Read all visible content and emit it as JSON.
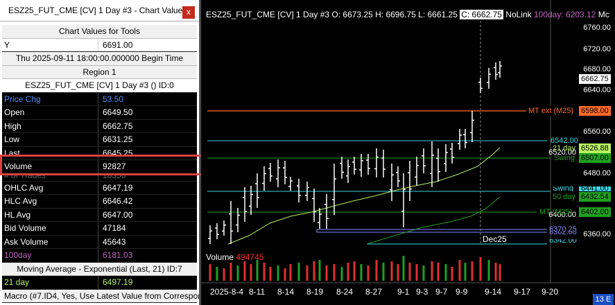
{
  "panel": {
    "title": "ESZ25_FUT_CME [CV]  1 Day  #3 - Chart Values...",
    "close": "x",
    "header": "Chart Values for Tools",
    "y_label": "Y",
    "y_value": "6691.00",
    "time": "Thu 2025-09-11  18:00:00.000000 Begin Time",
    "region": "Region 1",
    "symbol": "ESZ25_FUT_CME [CV]  1 Day  #3 ()   ID:0",
    "rows": [
      {
        "label": "Price Chg",
        "value": "53.50"
      },
      {
        "label": "Open",
        "value": "6649.50"
      },
      {
        "label": "High",
        "value": "6662.75"
      },
      {
        "label": "Low",
        "value": "6631.25"
      },
      {
        "label": "Last",
        "value": "6645.25"
      },
      {
        "label": "Volume",
        "value": "92827"
      },
      {
        "label": "# of Trades",
        "value": "18350"
      },
      {
        "label": "OHLC Avg",
        "value": "6647.19"
      },
      {
        "label": "HLC Avg",
        "value": "6646.42"
      },
      {
        "label": "HL Avg",
        "value": "6647.00"
      },
      {
        "label": "Bid Volume",
        "value": "47184"
      },
      {
        "label": "Ask Volume",
        "value": "45643"
      },
      {
        "label": "100day",
        "value": "6181.03"
      }
    ],
    "ma_header": "Moving Average - Exponential (Last, 21)   ID:7",
    "ma_row": {
      "label": "21 day",
      "value": "6497.19"
    },
    "macro": "Macro (#7.ID4, Yes, Use Latest Value from Correspon"
  },
  "chart": {
    "header": "ESZ25_FUT_CME [CV]  1 Day  #3 O: 6673.25 H: 6696.75 L: 6661.25",
    "close_value": "C: 6662.75",
    "nolink": "NoLink",
    "ma_text": "100day: 6203.12",
    "ma_suffix": "Mc",
    "volume_label": "Volume",
    "volume_value": "494745",
    "price_axis": [
      "6760.00",
      "6720.00",
      "6680.00",
      "6640.00",
      "6560.00",
      "6520.00",
      "6480.00",
      "6400.00",
      "6360.00"
    ],
    "dates": [
      "2025-8-4",
      "8-11",
      "8-14",
      "8-19",
      "8-24",
      "8-27",
      "9-1",
      "9-3",
      "9-7",
      "9-9",
      "9-14",
      "9-17",
      "9-20"
    ],
    "contract_label": "Dec25",
    "tags": {
      "current": "6662.75",
      "mt_ext_label": "MT ext (M25)",
      "mt_ext_value": "6598.00",
      "line_6542": "6542.00",
      "ma21_label": "21 day",
      "ma21_value": "6526.88",
      "swing_label": "Swing",
      "swing_value": "6507.00",
      "swing2_label": "Swing",
      "ma50_label": "50 day",
      "ma50_value": "6432.54",
      "box_6441": "6441.00",
      "mt_label": "MT (M25)",
      "mt_value": "6402.00",
      "line_6370": "6370.25",
      "line_6362": "6362.00",
      "line_6342": "6342.00"
    },
    "corner": "13 E"
  },
  "colors": {
    "orange": "#ff6a2a",
    "cyan": "#3ad8e6",
    "green": "#1fa01f",
    "lime": "#b8f060",
    "purple": "#c060c0",
    "lavender": "#8c8cff",
    "red": "#e03030"
  }
}
